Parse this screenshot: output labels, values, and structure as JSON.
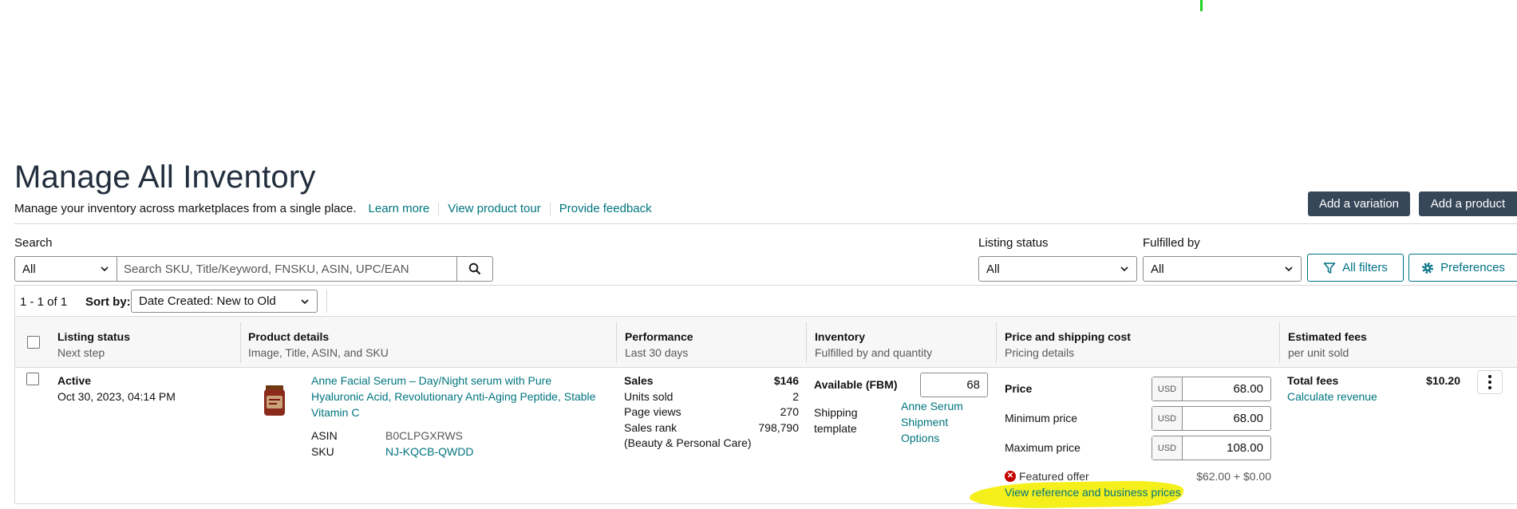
{
  "page": {
    "title": "Manage All Inventory",
    "subtitle": "Manage your inventory across marketplaces from a single place.",
    "links": [
      "Learn more",
      "View product tour",
      "Provide feedback"
    ],
    "add_variation_label": "Add a variation",
    "add_product_label": "Add a product"
  },
  "filters": {
    "search_label": "Search",
    "search_scope": "All",
    "search_placeholder": "Search SKU, Title/Keyword, FNSKU, ASIN, UPC/EAN",
    "listing_status_label": "Listing status",
    "listing_status_value": "All",
    "fulfilled_by_label": "Fulfilled by",
    "fulfilled_by_value": "All",
    "all_filters_label": "All filters",
    "preferences_label": "Preferences"
  },
  "results": {
    "count_text": "1 - 1 of 1",
    "sort_label": "Sort by:",
    "sort_value": "Date Created: New to Old"
  },
  "columns": [
    {
      "title": "Listing status",
      "subtitle": "Next step"
    },
    {
      "title": "Product details",
      "subtitle": "Image, Title, ASIN, and SKU"
    },
    {
      "title": "Performance",
      "subtitle": "Last 30 days"
    },
    {
      "title": "Inventory",
      "subtitle": "Fulfilled by and quantity"
    },
    {
      "title": "Price and shipping cost",
      "subtitle": "Pricing details"
    },
    {
      "title": "Estimated fees",
      "subtitle": "per unit sold"
    }
  ],
  "listing": {
    "status": "Active",
    "date": "Oct 30, 2023, 04:14 PM",
    "title_lines": [
      "Anne Facial Serum – Day/Night serum with Pure",
      "Hyaluronic Acid, Revolutionary Anti-Aging Peptide, Stable",
      "Vitamin C"
    ],
    "asin_label": "ASIN",
    "asin": "B0CLPGXRWS",
    "sku_label": "SKU",
    "sku": "NJ-KQCB-QWDD",
    "performance": {
      "sales_label": "Sales",
      "sales_value": "$146",
      "units_label": "Units sold",
      "units_value": "2",
      "views_label": "Page views",
      "views_value": "270",
      "rank_label": "Sales rank",
      "rank_value": "798,790",
      "rank_category": "(Beauty & Personal Care)"
    },
    "inventory": {
      "available_label": "Available (FBM)",
      "quantity": "68",
      "shipping_label_lines": [
        "Shipping",
        "template"
      ],
      "shipping_link_lines": [
        "Anne Serum",
        "Shipment",
        "Options"
      ]
    },
    "pricing": {
      "currency": "USD",
      "price_label": "Price",
      "price": "68.00",
      "min_label": "Minimum price",
      "min": "68.00",
      "max_label": "Maximum price",
      "max": "108.00",
      "featured_label": "Featured offer",
      "featured_value": "$62.00 + $0.00",
      "reference_link": "View reference and business prices"
    },
    "fees": {
      "total_label": "Total fees",
      "total_value": "$10.20",
      "calc_link": "Calculate revenue"
    }
  },
  "colors": {
    "accent_teal": "#00757f",
    "dark_button": "#37475a",
    "highlight": "#f5f01c",
    "error": "#c40000"
  }
}
